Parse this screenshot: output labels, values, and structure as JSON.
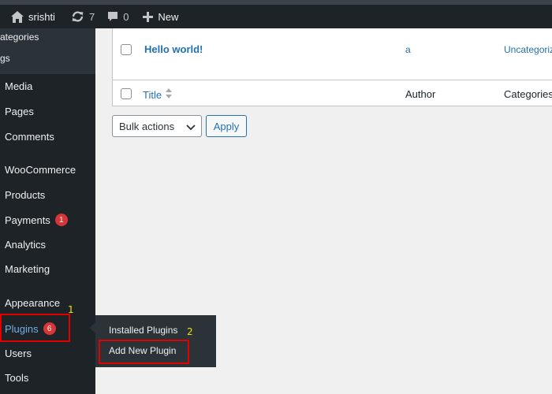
{
  "adminbar": {
    "site_name": "srishti",
    "updates_count": "7",
    "comments_count": "0",
    "new_label": "New"
  },
  "sidebar": {
    "submenu_partial": [
      "ategories",
      "gs"
    ],
    "items": [
      {
        "label": "Media"
      },
      {
        "label": "Pages"
      },
      {
        "label": "Comments"
      },
      {
        "label": "WooCommerce"
      },
      {
        "label": "Products"
      },
      {
        "label": "Payments",
        "badge": "1"
      },
      {
        "label": "Analytics"
      },
      {
        "label": "Marketing"
      },
      {
        "label": "Appearance"
      },
      {
        "label": "Plugins",
        "badge": "6"
      },
      {
        "label": "Users"
      },
      {
        "label": "Tools"
      }
    ]
  },
  "flyout": {
    "items": [
      "Installed Plugins",
      "Add New Plugin"
    ]
  },
  "annotations": {
    "step1": "1",
    "step2": "2",
    "color": "#e00000"
  },
  "table": {
    "row": {
      "title": "Hello world!",
      "author": "a",
      "category": "Uncategoriz"
    },
    "footer": {
      "title": "Title",
      "author": "Author",
      "categories": "Categories"
    }
  },
  "bulk": {
    "select_value": "Bulk actions",
    "apply_label": "Apply"
  },
  "colors": {
    "sidebar_bg": "#1d2327",
    "link": "#2271b1",
    "badge": "#d63638",
    "current": "#72aee6"
  }
}
